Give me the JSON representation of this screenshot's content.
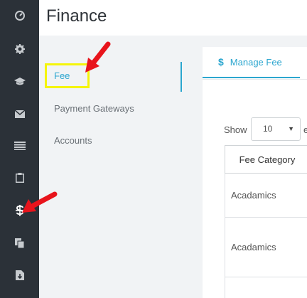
{
  "header": {
    "title": "Finance"
  },
  "rail": {
    "icons": [
      "dashboard-icon",
      "gear-icon",
      "graduation-cap-icon",
      "envelope-icon",
      "list-icon",
      "clipboard-icon",
      "dollar-icon",
      "copy-icon",
      "download-icon"
    ]
  },
  "submenu": {
    "items": [
      {
        "label": "Fee",
        "active": true
      },
      {
        "label": "Payment Gateways",
        "active": false
      },
      {
        "label": "Accounts",
        "active": false
      }
    ]
  },
  "tabs": [
    {
      "icon": "$",
      "label": "Manage Fee",
      "active": true
    }
  ],
  "table_controls": {
    "show_label": "Show",
    "length_value": "10",
    "after_label": "e"
  },
  "table": {
    "columns": [
      "Fee Category"
    ],
    "rows": [
      [
        "Acadamics"
      ],
      [
        "Acadamics"
      ],
      [
        ""
      ]
    ]
  },
  "colors": {
    "rail": "#2b3138",
    "accent": "#2ba6cf",
    "highlight": "#f5f50a",
    "annotation_arrow": "#e8141c"
  }
}
